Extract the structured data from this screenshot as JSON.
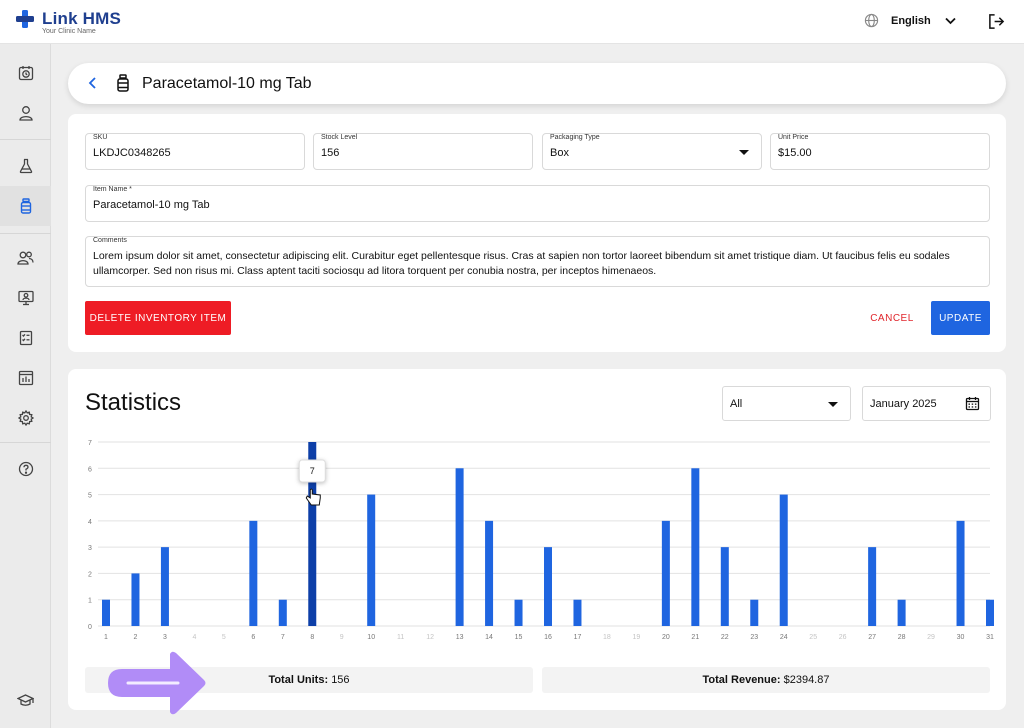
{
  "app": {
    "name": "Link HMS",
    "subtitle": "Your Clinic Name"
  },
  "topbar": {
    "language": "English"
  },
  "sidebar": {
    "items": [
      {
        "icon": "calendar-clock-icon",
        "active": false
      },
      {
        "icon": "user-icon",
        "active": false
      },
      {
        "icon": "flask-icon",
        "active": false
      },
      {
        "icon": "medicine-bottle-icon",
        "active": true
      },
      {
        "icon": "users-icon",
        "active": false
      },
      {
        "icon": "monitor-user-icon",
        "active": false
      },
      {
        "icon": "report-icon",
        "active": false
      },
      {
        "icon": "chart-report-icon",
        "active": false
      },
      {
        "icon": "gear-icon",
        "active": false
      },
      {
        "icon": "help-icon",
        "active": false
      },
      {
        "icon": "graduation-cap-icon",
        "active": false
      }
    ]
  },
  "header": {
    "title": "Paracetamol-10 mg Tab"
  },
  "form": {
    "sku": {
      "label": "SKU",
      "value": "LKDJC0348265"
    },
    "stock_level": {
      "label": "Stock Level",
      "value": "156"
    },
    "packaging_type": {
      "label": "Packaging Type",
      "value": "Box"
    },
    "unit_price": {
      "label": "Unit Price",
      "value": "$15.00"
    },
    "item_name": {
      "label": "Item Name *",
      "value": "Paracetamol-10 mg Tab"
    },
    "comments": {
      "label": "Comments",
      "value": "Lorem ipsum dolor sit amet, consectetur adipiscing elit. Curabitur eget pellentesque risus. Cras at sapien non tortor laoreet bibendum sit amet tristique diam. Ut faucibus felis eu sodales ullamcorper. Sed non risus mi. Class aptent taciti sociosqu ad litora torquent per conubia nostra, per inceptos himenaeos."
    },
    "delete_label": "DELETE INVENTORY ITEM",
    "cancel_label": "CANCEL",
    "update_label": "UPDATE"
  },
  "stats": {
    "title": "Statistics",
    "filter": "All",
    "month": "January 2025",
    "total_units_label": "Total Units:",
    "total_units_value": "156",
    "total_revenue_label": "Total Revenue:",
    "total_revenue_value": "$2394.87"
  },
  "chart_data": {
    "type": "bar",
    "categories": [
      "1",
      "2",
      "3",
      "4",
      "5",
      "6",
      "7",
      "8",
      "9",
      "10",
      "11",
      "12",
      "13",
      "14",
      "15",
      "16",
      "17",
      "18",
      "19",
      "20",
      "21",
      "22",
      "23",
      "24",
      "25",
      "26",
      "27",
      "28",
      "29",
      "30",
      "31"
    ],
    "values": [
      1,
      2,
      3,
      0,
      0,
      4,
      1,
      7,
      0,
      5,
      0,
      0,
      6,
      4,
      1,
      3,
      1,
      0,
      0,
      4,
      6,
      3,
      1,
      5,
      0,
      0,
      3,
      1,
      0,
      4,
      1
    ],
    "ylim": [
      0,
      7
    ],
    "yticks": [
      "0",
      "1",
      "2",
      "3",
      "4",
      "5",
      "6",
      "7"
    ],
    "grid": true,
    "highlight_index": 7,
    "tooltip": "7",
    "colors": {
      "bar": "#1f65e0",
      "highlight": "#0d3fa8",
      "zero_label": "#c4c4c4",
      "label": "#777777"
    }
  },
  "colors": {
    "primary": "#1f65e0",
    "danger": "#ee1c25",
    "brand": "#1f3f8f",
    "annotation_arrow": "#b18cf7"
  }
}
